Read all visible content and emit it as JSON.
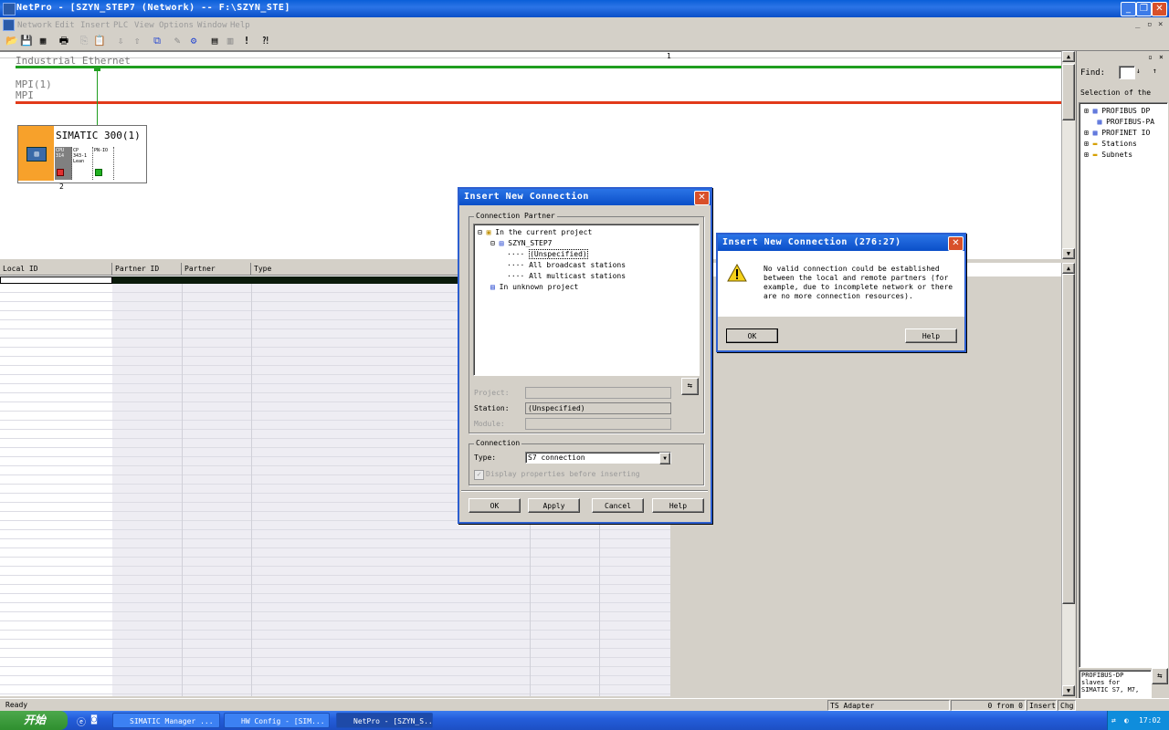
{
  "window": {
    "title": "NetPro - [SZYN_STEP7 (Network) -- F:\\SZYN_STE]"
  },
  "menu": [
    "Network",
    "Edit",
    "Insert",
    "PLC",
    "View",
    "Options",
    "Window",
    "Help"
  ],
  "network": {
    "ruler_number": "1",
    "ethernet_label": "Industrial Ethernet",
    "mpi_label_1": "MPI(1)",
    "mpi_label_2": "MPI",
    "station_name": "SIMATIC 300(1)",
    "station_number": "2",
    "modules": [
      "CPU 314",
      "CP 343-1 Lean",
      "PN-IO"
    ]
  },
  "table": {
    "columns": [
      "Local ID",
      "Partner ID",
      "Partner",
      "Type"
    ]
  },
  "catalog": {
    "find_label": "Find:",
    "selection_label": "Selection of the",
    "items": [
      "PROFIBUS DP",
      "PROFIBUS-PA",
      "PROFINET IO",
      "Stations",
      "Subnets"
    ],
    "info_lines": [
      "PROFIBUS-DP",
      "slaves for",
      "SIMATIC S7, M7,"
    ]
  },
  "insert_dialog": {
    "title": "Insert New Connection",
    "partner_group": "Connection Partner",
    "tree": [
      "In the current project",
      "SZYN_STEP7",
      "(Unspecified)",
      "All broadcast stations",
      "All multicast stations",
      "In unknown project"
    ],
    "project_label": "Project:",
    "station_label": "Station:",
    "station_value": "(Unspecified)",
    "module_label": "Module:",
    "connection_group": "Connection",
    "type_label": "Type:",
    "type_value": "S7 connection",
    "checkbox_label": "Display properties before inserting",
    "buttons": {
      "ok": "OK",
      "apply": "Apply",
      "cancel": "Cancel",
      "help": "Help"
    }
  },
  "error_dialog": {
    "title": "Insert New Connection (276:27)",
    "message_lines": [
      "No valid connection could be established",
      "between the local and remote partners (for",
      "example, due to incomplete network or there",
      "are no more connection resources)."
    ],
    "ok": "OK",
    "help": "Help"
  },
  "status": {
    "left": "Ready",
    "adapter": "TS Adapter",
    "selection": "0 from 0 selected",
    "insert": "Insert",
    "chg": "Chg"
  },
  "taskbar": {
    "start": "开始",
    "tasks": [
      "SIMATIC Manager ...",
      "HW Config - [SIM...",
      "NetPro - [SZYN_S..."
    ],
    "clock": "17:02"
  },
  "colors": {
    "ethernet_bus": "#1f9e1f",
    "mpi_bus": "#e23a1a",
    "cpu_orange": "#f7a12b",
    "titlebar": "#0a4fc8"
  }
}
